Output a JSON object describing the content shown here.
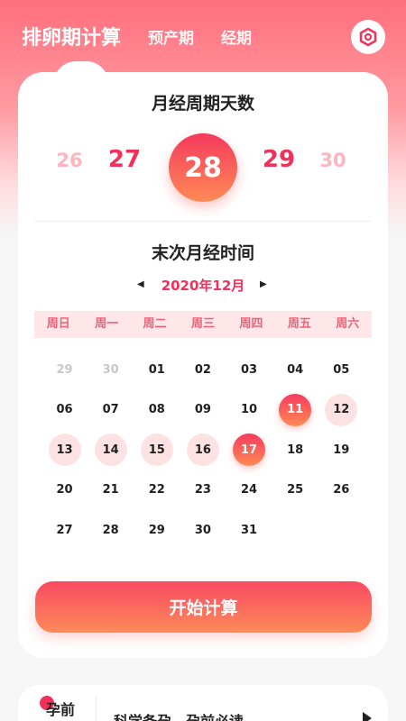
{
  "tabs": [
    {
      "label": "排卵期计算",
      "active": true
    },
    {
      "label": "预产期",
      "active": false
    },
    {
      "label": "经期",
      "active": false
    }
  ],
  "settings_icon": "hexagon-settings-icon",
  "cycle": {
    "title": "月经周期天数",
    "options": [
      "26",
      "27",
      "28",
      "29",
      "30"
    ],
    "selected": "28"
  },
  "calendar": {
    "title": "末次月经时间",
    "month_label": "2020年12月",
    "weekdays": [
      "周日",
      "周一",
      "周二",
      "周三",
      "周四",
      "周五",
      "周六"
    ],
    "weeks": [
      [
        {
          "d": "29",
          "s": "muted"
        },
        {
          "d": "30",
          "s": "muted"
        },
        {
          "d": "01",
          "s": ""
        },
        {
          "d": "02",
          "s": ""
        },
        {
          "d": "03",
          "s": ""
        },
        {
          "d": "04",
          "s": ""
        },
        {
          "d": "05",
          "s": ""
        }
      ],
      [
        {
          "d": "06",
          "s": ""
        },
        {
          "d": "07",
          "s": ""
        },
        {
          "d": "08",
          "s": ""
        },
        {
          "d": "09",
          "s": ""
        },
        {
          "d": "10",
          "s": ""
        },
        {
          "d": "11",
          "s": "selected"
        },
        {
          "d": "12",
          "s": "period"
        }
      ],
      [
        {
          "d": "13",
          "s": "period"
        },
        {
          "d": "14",
          "s": "period"
        },
        {
          "d": "15",
          "s": "period"
        },
        {
          "d": "16",
          "s": "period"
        },
        {
          "d": "17",
          "s": "selected"
        },
        {
          "d": "18",
          "s": ""
        },
        {
          "d": "19",
          "s": ""
        }
      ],
      [
        {
          "d": "20",
          "s": ""
        },
        {
          "d": "21",
          "s": ""
        },
        {
          "d": "22",
          "s": ""
        },
        {
          "d": "23",
          "s": ""
        },
        {
          "d": "24",
          "s": ""
        },
        {
          "d": "25",
          "s": ""
        },
        {
          "d": "26",
          "s": ""
        }
      ],
      [
        {
          "d": "27",
          "s": ""
        },
        {
          "d": "28",
          "s": ""
        },
        {
          "d": "29",
          "s": ""
        },
        {
          "d": "30",
          "s": ""
        },
        {
          "d": "31",
          "s": ""
        },
        {
          "d": "",
          "s": ""
        },
        {
          "d": "",
          "s": ""
        }
      ]
    ]
  },
  "start_button": "开始计算",
  "bottom": {
    "label": "孕前",
    "text": "科学备孕，孕前必读"
  },
  "colors": {
    "accent": "#f2315a",
    "gradient_start": "#f53a5e",
    "gradient_end": "#ff8a55",
    "period_bg": "#fde2e4"
  }
}
